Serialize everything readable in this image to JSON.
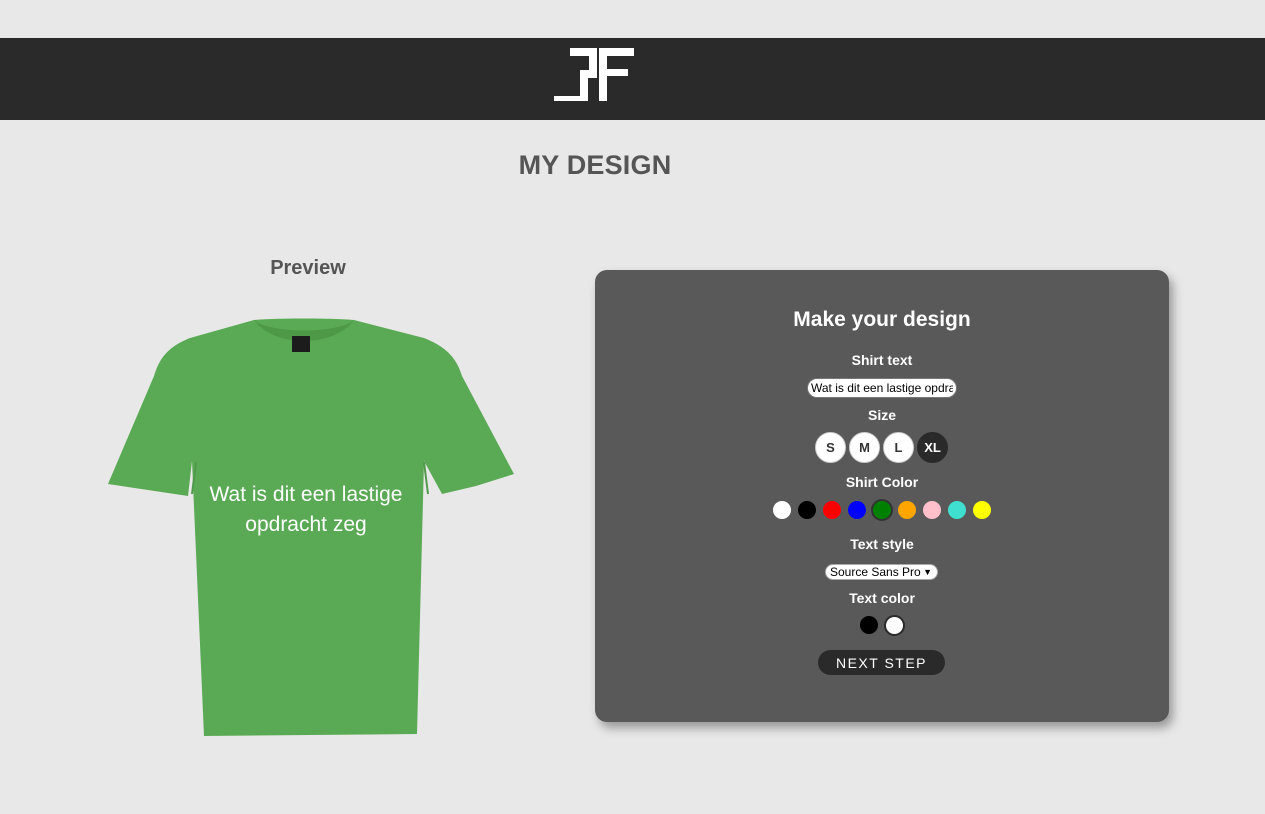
{
  "header": {
    "logo_text": "RF"
  },
  "page": {
    "title": "MY DESIGN"
  },
  "preview": {
    "title": "Preview",
    "shirt_text": "Wat is dit een lastige opdracht zeg",
    "shirt_color": "#5aaa55",
    "text_color": "#ffffff"
  },
  "design": {
    "title": "Make your design",
    "shirt_text_label": "Shirt text",
    "shirt_text_value": "Wat is dit een lastige opdracht zeg",
    "size_label": "Size",
    "sizes": [
      "S",
      "M",
      "L",
      "XL"
    ],
    "selected_size": "XL",
    "shirt_color_label": "Shirt Color",
    "shirt_colors": [
      {
        "name": "white",
        "hex": "#ffffff"
      },
      {
        "name": "black",
        "hex": "#000000"
      },
      {
        "name": "red",
        "hex": "#ff0000"
      },
      {
        "name": "blue",
        "hex": "#0000ff"
      },
      {
        "name": "green",
        "hex": "#008000",
        "selected": true
      },
      {
        "name": "orange",
        "hex": "#ffa500"
      },
      {
        "name": "pink",
        "hex": "#ffc0cb"
      },
      {
        "name": "turquoise",
        "hex": "#40e0d0"
      },
      {
        "name": "yellow",
        "hex": "#ffff00"
      }
    ],
    "text_style_label": "Text style",
    "text_style_value": "Source Sans Pro",
    "text_color_label": "Text color",
    "text_colors": [
      {
        "name": "black",
        "hex": "#000000"
      },
      {
        "name": "white",
        "hex": "#ffffff",
        "selected": true
      }
    ],
    "next_button": "NEXT STEP"
  }
}
